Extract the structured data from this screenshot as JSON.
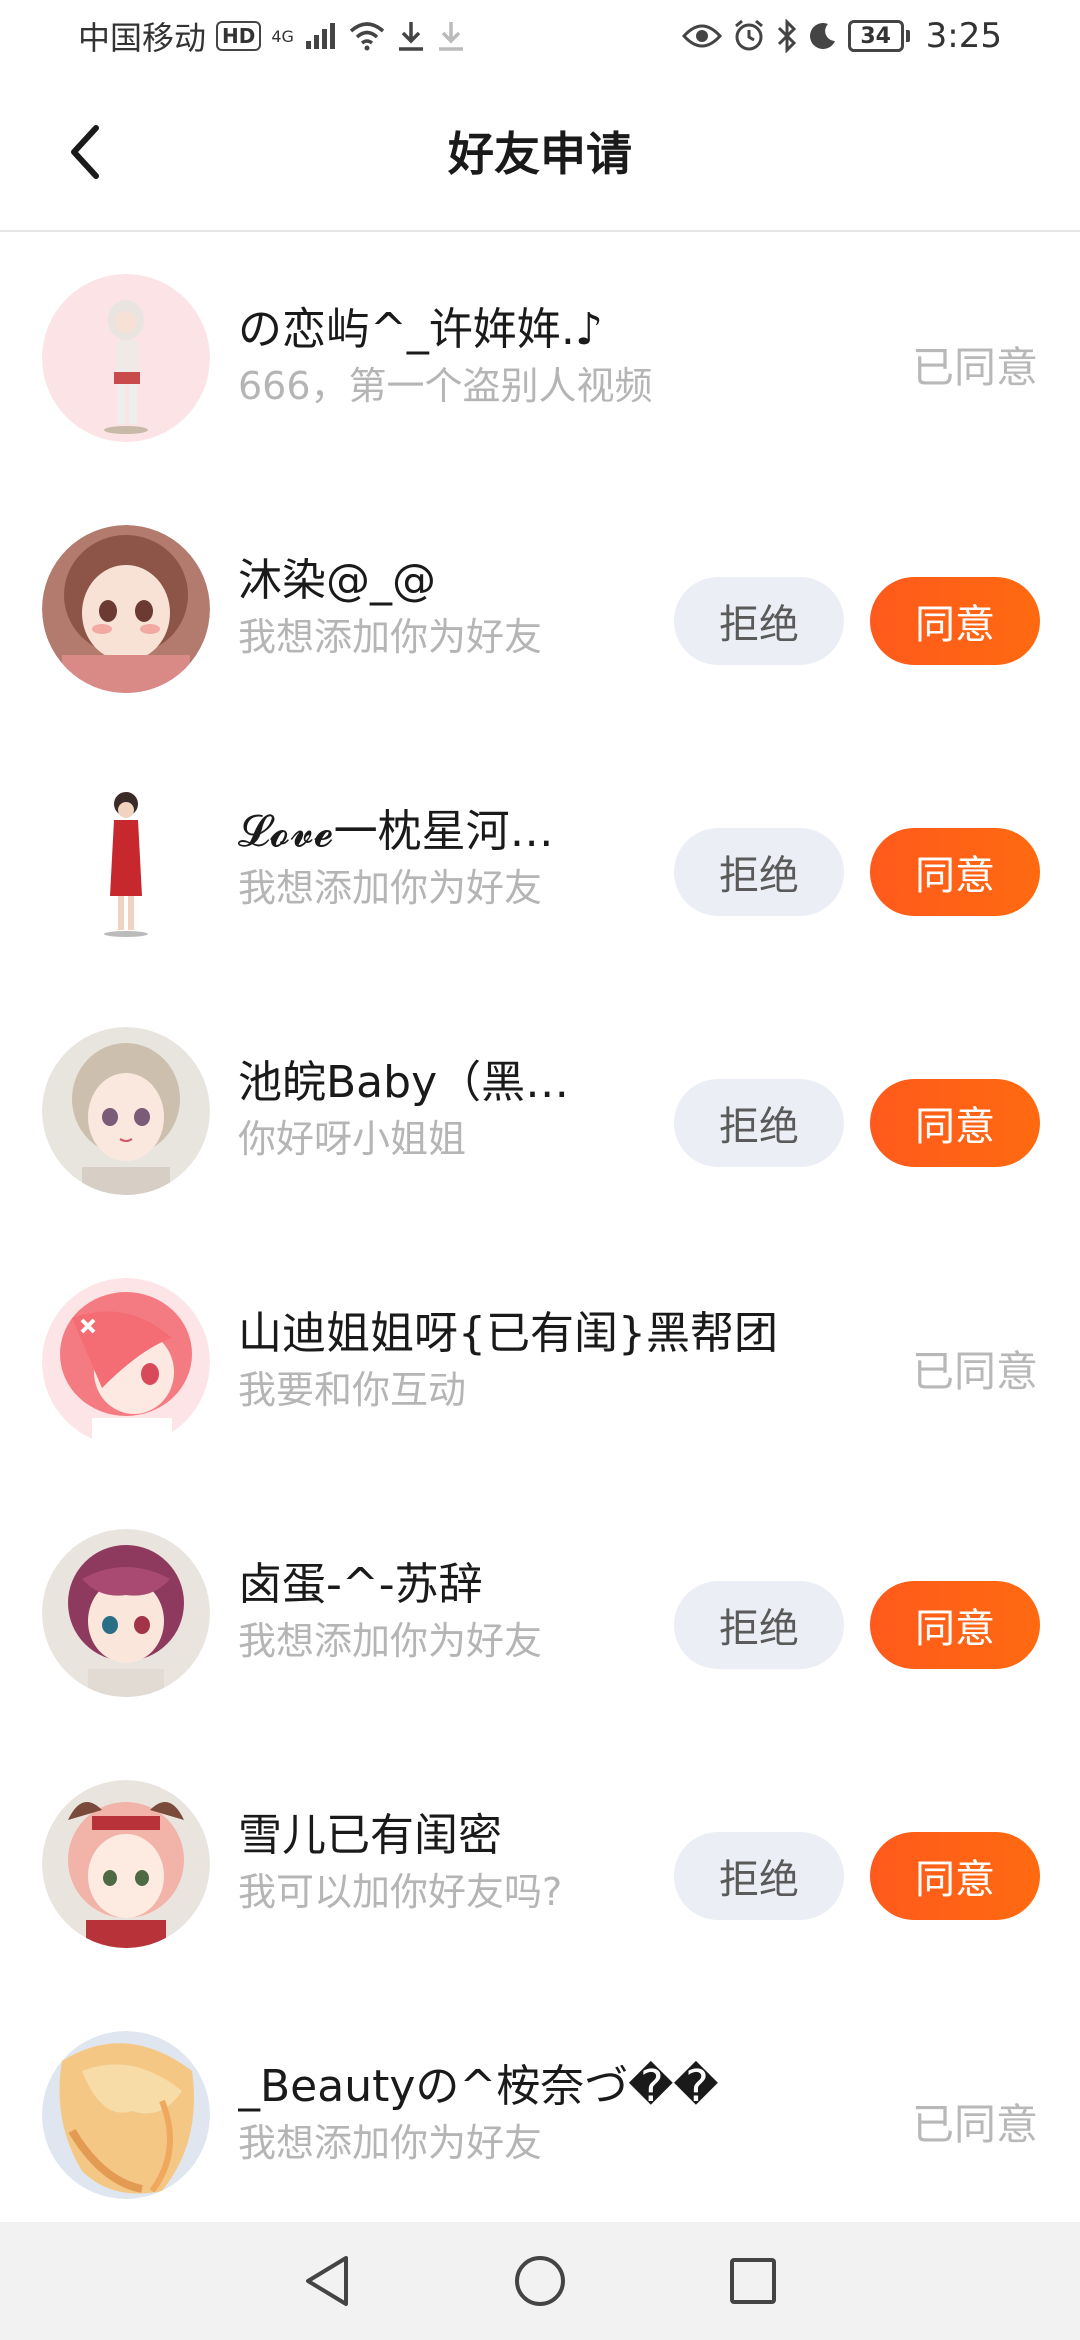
{
  "status_bar": {
    "carrier": "中国移动",
    "hd_badge": "HD",
    "network": "4G",
    "battery": "34",
    "time": "3:25"
  },
  "header": {
    "title": "好友申请"
  },
  "requests": [
    {
      "name": "の恋屿^_许姩姩.♪",
      "message": "666，第一个盗别人视频",
      "status": "已同意"
    },
    {
      "name": "沐染@_@",
      "message": "我想添加你为好友",
      "reject_label": "拒绝",
      "accept_label": "同意"
    },
    {
      "name": "𝓛𝓸𝓿𝓮一枕星河…",
      "message": "我想添加你为好友",
      "reject_label": "拒绝",
      "accept_label": "同意"
    },
    {
      "name": "池皖Baby（黑…",
      "message": "你好呀小姐姐",
      "reject_label": "拒绝",
      "accept_label": "同意"
    },
    {
      "name": "山迪姐姐呀{已有闺}黑帮团",
      "message": "我要和你互动",
      "status": "已同意"
    },
    {
      "name": "卤蛋-^-苏辞",
      "message": "我想添加你为好友",
      "reject_label": "拒绝",
      "accept_label": "同意"
    },
    {
      "name": "雪儿已有闺密",
      "message": "我可以加你好友吗?",
      "reject_label": "拒绝",
      "accept_label": "同意"
    },
    {
      "name": "_Beautyの^桉奈づ��",
      "message": "我想添加你为好友",
      "status": "已同意"
    }
  ],
  "colors": {
    "accent": "#ff5e17",
    "reject_bg": "#eceef5",
    "muted_text": "#b5b5b5"
  }
}
